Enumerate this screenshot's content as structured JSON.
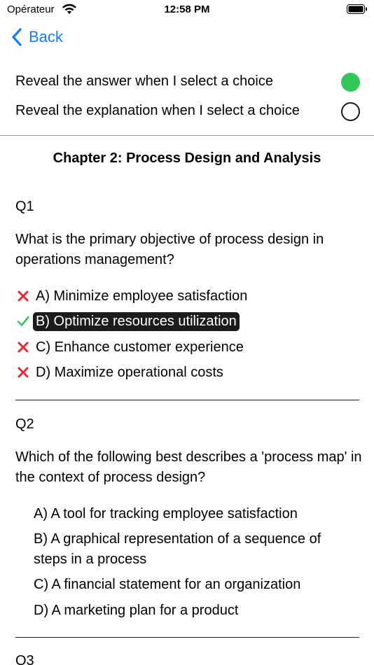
{
  "status_bar": {
    "carrier": "Opérateur",
    "time": "12:58 PM"
  },
  "nav": {
    "back_label": "Back"
  },
  "settings": {
    "reveal_answer_label": "Reveal the answer when I select a choice",
    "reveal_answer_on": true,
    "reveal_explanation_label": "Reveal the explanation when I select a choice",
    "reveal_explanation_on": false
  },
  "chapter": {
    "title": "Chapter 2: Process Design and Analysis"
  },
  "questions": [
    {
      "number": "Q1",
      "text": "What is the primary objective of process design in operations management?",
      "choices": [
        {
          "label": "A) Minimize employee satisfaction",
          "status": "wrong"
        },
        {
          "label": "B) Optimize resources utilization",
          "status": "correct-selected"
        },
        {
          "label": "C) Enhance customer experience",
          "status": "wrong"
        },
        {
          "label": "D) Maximize operational costs",
          "status": "wrong"
        }
      ]
    },
    {
      "number": "Q2",
      "text": "Which of the following best describes a 'process map' in the context of process design?",
      "choices": [
        {
          "label": "A) A tool for tracking employee satisfaction"
        },
        {
          "label": "B) A graphical representation of a sequence of steps in a process"
        },
        {
          "label": "C) A financial statement for an organization"
        },
        {
          "label": "D) A marketing plan for a product"
        }
      ]
    },
    {
      "number": "Q3"
    }
  ],
  "colors": {
    "accent": "#1a7cf5",
    "toggle_on": "#33c759",
    "wrong": "#e8292f",
    "correct": "#33c759"
  }
}
